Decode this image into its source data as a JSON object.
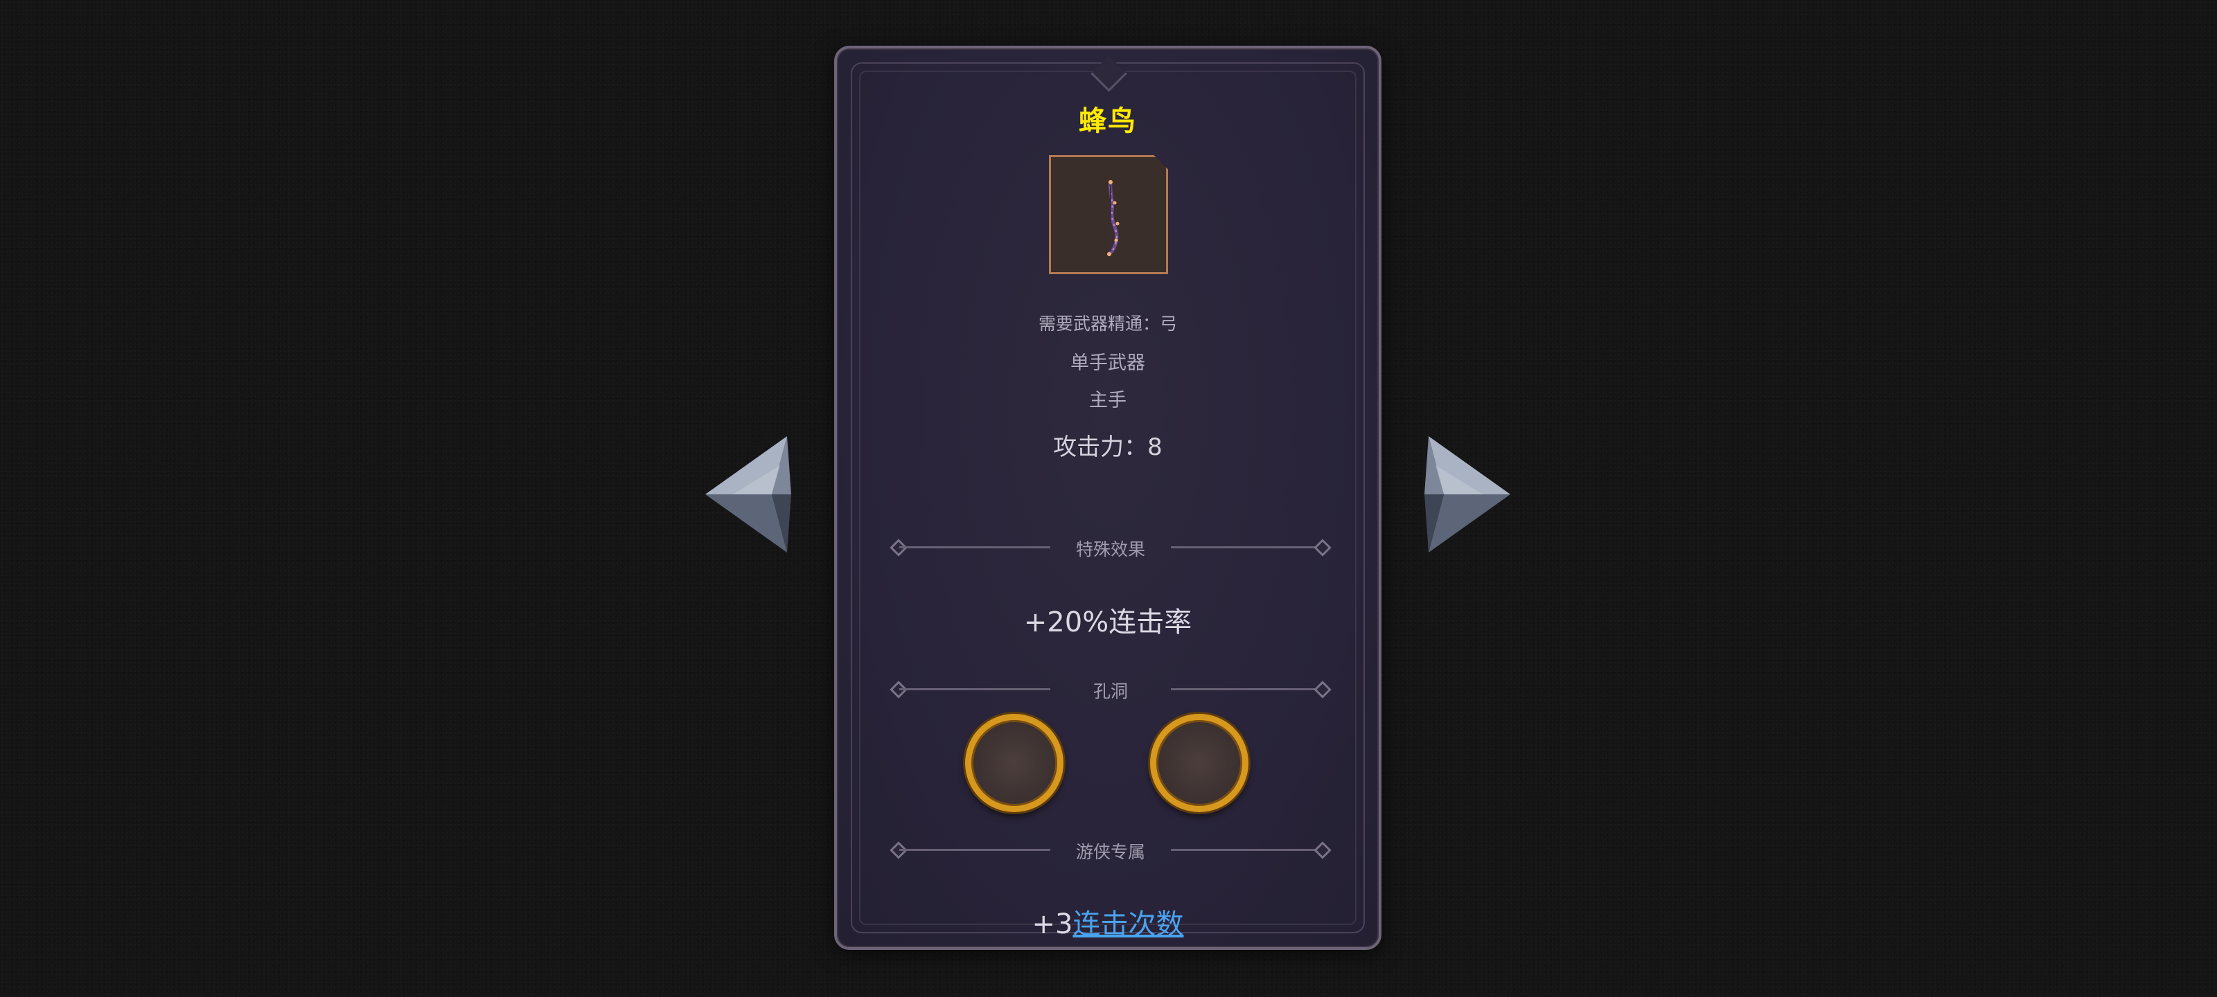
{
  "item": {
    "name": "蜂鸟",
    "requirement": "需要武器精通：弓",
    "hand_type": "单手武器",
    "slot": "主手",
    "attack": "攻击力：8"
  },
  "sections": {
    "special_effect": {
      "header": "特殊效果",
      "text": "+20%连击率"
    },
    "holes": {
      "header": "孔洞",
      "count": 2
    },
    "ranger": {
      "header": "游侠专属",
      "prefix": "+3",
      "link": "连击次数"
    }
  },
  "colors": {
    "title": "#ffea00",
    "link": "#4aa3f0",
    "socket_ring": "#d7981e",
    "card_border": "#6e6478"
  },
  "icons": {
    "prev": "arrow-left-icon",
    "next": "arrow-right-icon"
  }
}
